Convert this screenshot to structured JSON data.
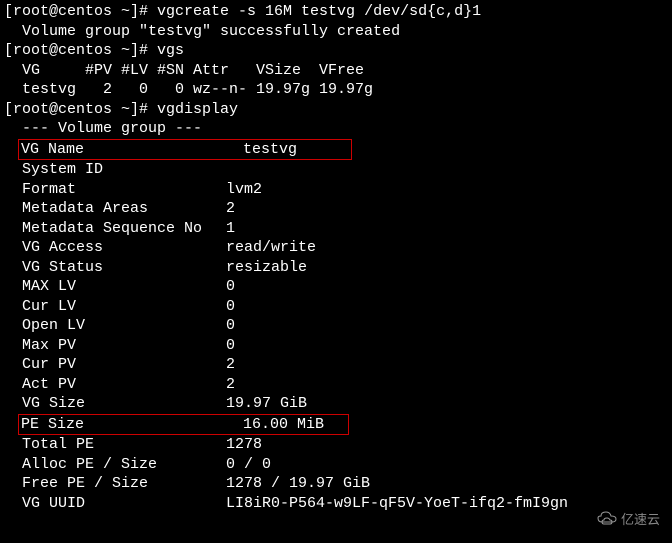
{
  "lines": {
    "l1_prompt": "[root@centos ~]# ",
    "l1_cmd": "vgcreate -s 16M testvg /dev/sd{c,d}1",
    "l2": "  Volume group \"testvg\" successfully created",
    "l3_prompt": "[root@centos ~]# ",
    "l3_cmd": "vgs",
    "l4": "  VG     #PV #LV #SN Attr   VSize  VFree",
    "l5": "  testvg   2   0   0 wz--n- 19.97g 19.97g",
    "l6_prompt": "[root@centos ~]# ",
    "l6_cmd": "vgdisplay",
    "l7": "  --- Volume group ---"
  },
  "vg": {
    "name_label": "VG Name",
    "name_value": "testvg",
    "sysid_label": "System ID",
    "sysid_value": "",
    "format_label": "Format",
    "format_value": "lvm2",
    "mdareas_label": "Metadata Areas",
    "mdareas_value": "2",
    "mdseq_label": "Metadata Sequence No",
    "mdseq_value": "1",
    "access_label": "VG Access",
    "access_value": "read/write",
    "status_label": "VG Status",
    "status_value": "resizable",
    "maxlv_label": "MAX LV",
    "maxlv_value": "0",
    "curlv_label": "Cur LV",
    "curlv_value": "0",
    "openlv_label": "Open LV",
    "openlv_value": "0",
    "maxpv_label": "Max PV",
    "maxpv_value": "0",
    "curpv_label": "Cur PV",
    "curpv_value": "2",
    "actpv_label": "Act PV",
    "actpv_value": "2",
    "vgsize_label": "VG Size",
    "vgsize_value": "19.97 GiB",
    "pesize_label": "PE Size",
    "pesize_value": "16.00 MiB",
    "totalpe_label": "Total PE",
    "totalpe_value": "1278",
    "allocpe_label": "Alloc PE / Size",
    "allocpe_value": "0 / 0",
    "freepe_label": "Free  PE / Size",
    "freepe_value": "1278 / 19.97 GiB",
    "uuid_label": "VG UUID",
    "uuid_value": "LI8iR0-P564-w9LF-qF5V-YoeT-ifq2-fmI9gn"
  },
  "watermark": "亿速云"
}
